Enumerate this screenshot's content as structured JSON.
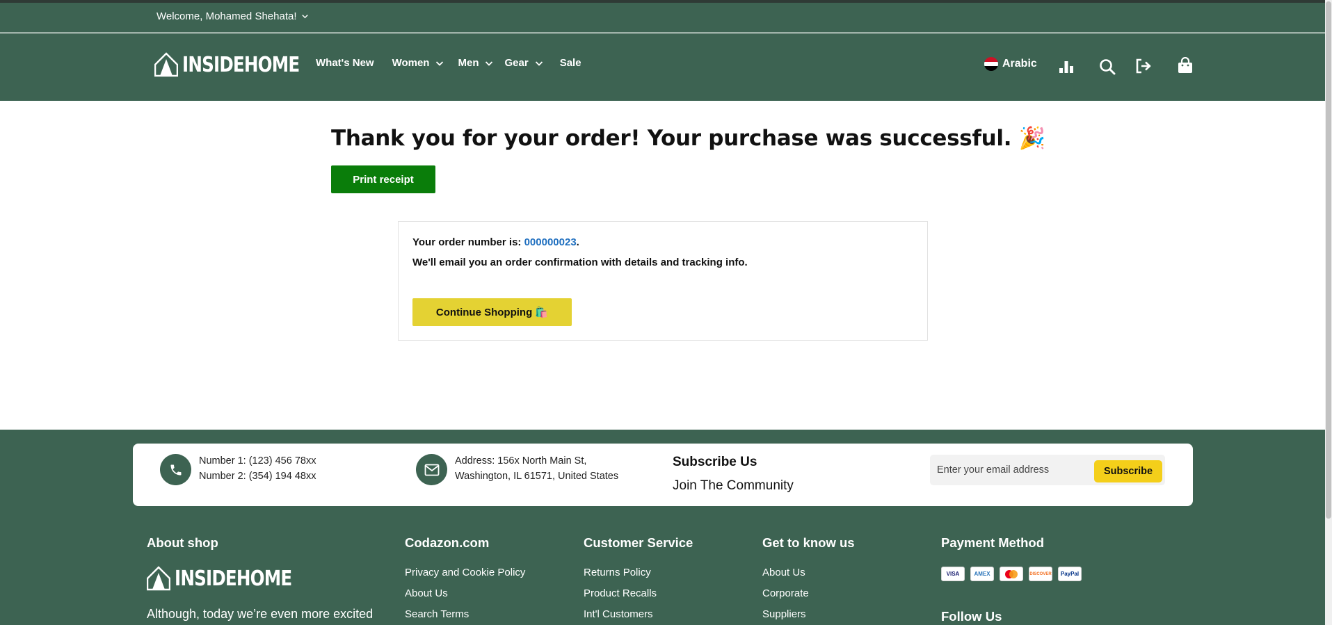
{
  "topbar": {
    "welcome": "Welcome, Mohamed Shehata!"
  },
  "header": {
    "logo_text": "INSIDEHOME",
    "nav": [
      {
        "label": "What's New",
        "has_dropdown": false
      },
      {
        "label": "Women",
        "has_dropdown": true
      },
      {
        "label": "Men",
        "has_dropdown": true
      },
      {
        "label": "Gear",
        "has_dropdown": true
      },
      {
        "label": "Sale",
        "has_dropdown": false
      }
    ],
    "language": "Arabic",
    "icons": [
      "compare-icon",
      "search-icon",
      "logout-icon",
      "cart-icon"
    ]
  },
  "main": {
    "title": "Thank you for your order! Your purchase was successful. 🎉",
    "print_label": "Print receipt",
    "order_prefix": "Your order number is: ",
    "order_number": "000000023",
    "order_suffix": ".",
    "confirmation": "We'll email you an order confirmation with details and tracking info.",
    "continue_label": "Continue Shopping 🛍️"
  },
  "footer": {
    "phone1": "Number 1: (123) 456 78xx",
    "phone2": "Number 2: (354) 194 48xx",
    "address1": "Address: 156x North Main St,",
    "address2": "Washington, IL 61571, United States",
    "subscribe_title": "Subscribe Us",
    "subscribe_tagline": "Join The Community",
    "email_placeholder": "Enter your email address",
    "subscribe_label": "Subscribe",
    "about": {
      "title": "About shop",
      "logo_text": "INSIDEHOME",
      "text": "Although, today we’re even more excited"
    },
    "columns": [
      {
        "title": "Codazon.com",
        "links": [
          "Privacy and Cookie Policy",
          "About Us",
          "Search Terms"
        ]
      },
      {
        "title": "Customer Service",
        "links": [
          "Returns Policy",
          "Product Recalls",
          "Int'l Customers"
        ]
      },
      {
        "title": "Get to know us",
        "links": [
          "About Us",
          "Corporate",
          "Suppliers"
        ]
      }
    ],
    "payment_title": "Payment Method",
    "payment_cards": [
      "VISA",
      "AMEX",
      "MasterCard",
      "DISCOVER",
      "PayPal"
    ],
    "follow_title": "Follow Us"
  },
  "colors": {
    "brand_green": "#3d6352",
    "print_button": "#0a7d0a",
    "continue_button": "#e4d233",
    "subscribe_button": "#f4cf1a",
    "order_link": "#1f6fbf"
  }
}
